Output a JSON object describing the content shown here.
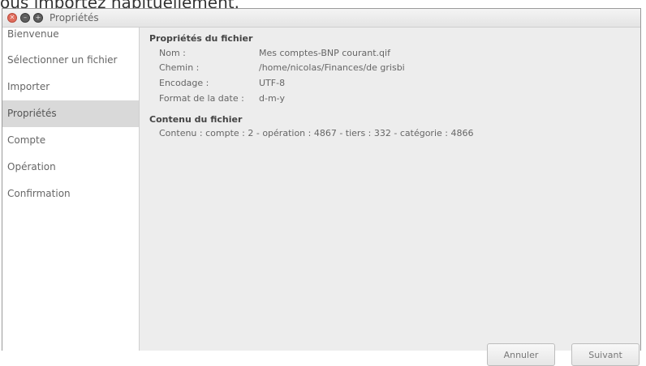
{
  "caption": "ous importez habituellement.",
  "window": {
    "title": "Propriétés"
  },
  "sidebar": {
    "items": [
      {
        "label": "Bienvenue"
      },
      {
        "label": "Sélectionner un fichier"
      },
      {
        "label": "Importer"
      },
      {
        "label": "Propriétés"
      },
      {
        "label": "Compte"
      },
      {
        "label": "Opération"
      },
      {
        "label": "Confirmation"
      }
    ],
    "active_index": 3
  },
  "file_properties": {
    "heading": "Propriétés du fichier",
    "rows": [
      {
        "label": "Nom :",
        "value": "Mes comptes-BNP courant.qif"
      },
      {
        "label": "Chemin :",
        "value": "/home/nicolas/Finances/de grisbi"
      },
      {
        "label": "Encodage :",
        "value": "UTF-8"
      },
      {
        "label": "Format de la date :",
        "value": "d-m-y"
      }
    ]
  },
  "file_contents": {
    "heading": "Contenu du fichier",
    "label": "Contenu :",
    "value": "compte : 2 - opération : 4867 - tiers : 332 - catégorie : 4866"
  },
  "buttons": {
    "cancel": "Annuler",
    "next": "Suivant"
  }
}
